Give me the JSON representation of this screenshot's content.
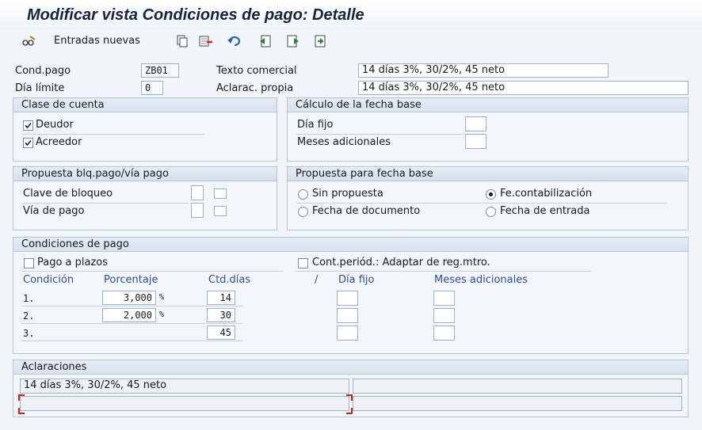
{
  "window": {
    "title": "Modificar vista Condiciones de pago: Detalle"
  },
  "toolbar": {
    "new_entries_label": "Entradas nuevas",
    "icons": [
      "glasses-pencil-icon",
      "copy-icon",
      "delete-icon",
      "undo-icon",
      "previous-entry-icon",
      "next-entry-icon",
      "other-entry-icon"
    ]
  },
  "header": {
    "cond_pago_label": "Cond.pago",
    "cond_pago_value": "ZB01",
    "texto_comercial_label": "Texto comercial",
    "texto_comercial_value": "14 días 3%, 30/2%, 45 neto",
    "dia_limite_label": "Día límite",
    "dia_limite_value": "0",
    "aclarac_label": "Aclarac. propia",
    "aclarac_value": "14 días 3%, 30/2%, 45 neto"
  },
  "clase_cuenta": {
    "title": "Clase de cuenta",
    "deudor": {
      "label": "Deudor",
      "checked": true
    },
    "acreedor": {
      "label": "Acreedor",
      "checked": true
    }
  },
  "calculo_fecha": {
    "title": "Cálculo de la fecha base",
    "dia_fijo_label": "Día fijo",
    "meses_label": "Meses adicionales"
  },
  "propuesta_blq": {
    "title": "Propuesta blq.pago/vía pago",
    "clave_label": "Clave de bloqueo",
    "via_label": "Vía de pago"
  },
  "propuesta_fecha": {
    "title": "Propuesta para fecha base",
    "options": [
      "Sin propuesta",
      "Fe.contabilización",
      "Fecha de documento",
      "Fecha de entrada"
    ],
    "selected": "Fe.contabilización"
  },
  "condiciones": {
    "title": "Condiciones de pago",
    "pago_plazos_label": "Pago a plazos",
    "cont_period_label": "Cont.periód.: Adaptar de reg.mtro.",
    "col_condicion": "Condición",
    "col_porcentaje": "Porcentaje",
    "col_ctd_dias": "Ctd.días",
    "col_slash": "/",
    "col_dia_fijo": "Día fijo",
    "col_meses": "Meses adicionales",
    "rows": [
      {
        "n": "1.",
        "pct": "3,000",
        "unit": "%",
        "dias": "14"
      },
      {
        "n": "2.",
        "pct": "2,000",
        "unit": "%",
        "dias": "30"
      },
      {
        "n": "3.",
        "pct": "",
        "unit": "",
        "dias": "45"
      }
    ]
  },
  "aclaraciones": {
    "title": "Aclaraciones",
    "line1": "14 días 3%, 30/2%, 45 neto"
  }
}
